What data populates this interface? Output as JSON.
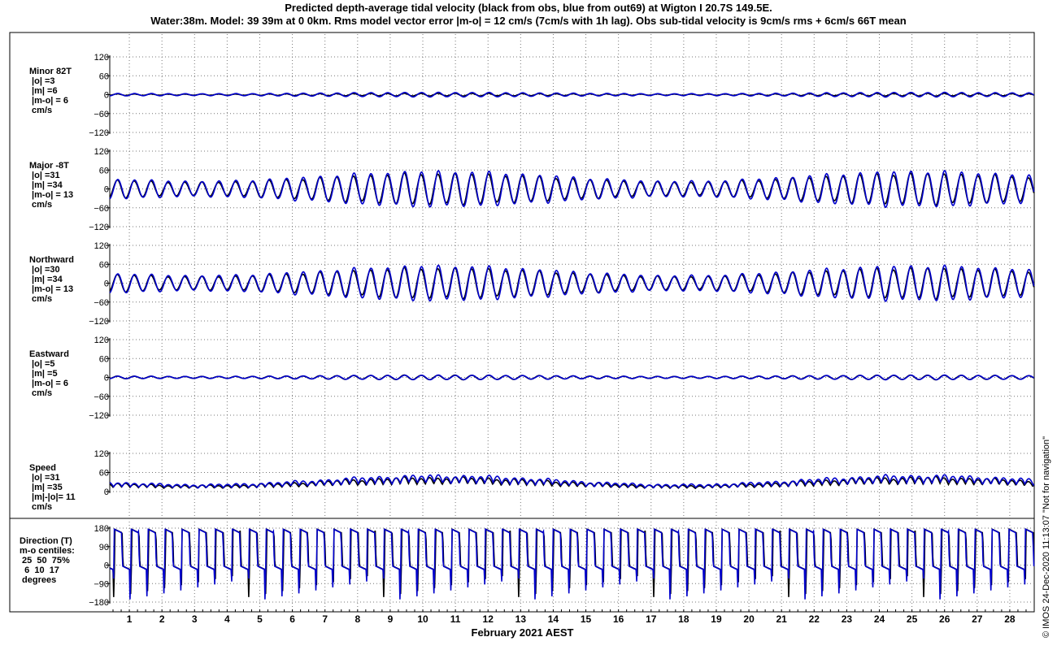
{
  "title_line1": "Predicted depth-average tidal velocity (black from obs, blue from out69) at Wigton I 20.7S 149.5E.",
  "title_line2": "Water:38m. Model: 39 39m at 0 0km. Rms model vector error |m-o| = 12 cm/s (7cm/s with 1h lag). Obs sub-tidal velocity is 9cm/s rms + 6cm/s 66T mean",
  "xlabel": "February 2021 AEST",
  "copyright": "© IMOS 24-Dec-2020 11:13:07  \"Not for navigation\"",
  "colors": {
    "obs": "#000000",
    "model": "#0000cc",
    "grid": "#777777"
  },
  "chart_data": [
    {
      "type": "line",
      "name": "minor",
      "label": [
        "Minor 82T",
        " |o| =3",
        " |m| =6",
        " |m-o| = 6",
        " cm/s"
      ],
      "ylim": [
        -120,
        120
      ],
      "yticks": [
        -120,
        -60,
        0,
        60,
        120
      ],
      "obs_amp": 4,
      "model_amp": 7,
      "tidal": true,
      "series": [
        {
          "name": "obs"
        },
        {
          "name": "model"
        }
      ]
    },
    {
      "type": "line",
      "name": "major",
      "label": [
        "Major -8T",
        " |o| =31",
        " |m| =34",
        " |m-o| = 13",
        " cm/s"
      ],
      "ylim": [
        -120,
        120
      ],
      "yticks": [
        -120,
        -60,
        0,
        60,
        120
      ],
      "obs_amp": 48,
      "model_amp": 55,
      "tidal": true,
      "series": [
        {
          "name": "obs"
        },
        {
          "name": "model"
        }
      ]
    },
    {
      "type": "line",
      "name": "northward",
      "label": [
        "Northward",
        " |o| =30",
        " |m| =34",
        " |m-o| = 13",
        " cm/s"
      ],
      "ylim": [
        -120,
        120
      ],
      "yticks": [
        -120,
        -60,
        0,
        60,
        120
      ],
      "obs_amp": 47,
      "model_amp": 54,
      "tidal": true,
      "series": [
        {
          "name": "obs"
        },
        {
          "name": "model"
        }
      ]
    },
    {
      "type": "line",
      "name": "eastward",
      "label": [
        "Eastward",
        " |o| =5",
        " |m| =5",
        " |m-o| = 6",
        " cm/s"
      ],
      "ylim": [
        -120,
        120
      ],
      "yticks": [
        -120,
        -60,
        0,
        60,
        120
      ],
      "obs_amp": 7,
      "model_amp": 7,
      "tidal": true,
      "series": [
        {
          "name": "obs"
        },
        {
          "name": "model"
        }
      ]
    },
    {
      "type": "line",
      "name": "speed",
      "label": [
        "Speed",
        " |o| =31",
        " |m| =35",
        " |m|-|o|= 11",
        " cm/s"
      ],
      "ylim": [
        0,
        120
      ],
      "yticks": [
        0,
        60,
        120
      ],
      "obs_amp": 48,
      "model_amp": 55,
      "speed": true,
      "series": [
        {
          "name": "obs"
        },
        {
          "name": "model"
        }
      ]
    },
    {
      "type": "line",
      "name": "direction",
      "label": [
        "Direction (T)",
        "m-o centiles:",
        " 25  50  75%",
        "  6  10  17",
        " degrees"
      ],
      "ylim": [
        -180,
        180
      ],
      "yticks": [
        -180,
        -90,
        0,
        90,
        180
      ],
      "direction": true,
      "series": [
        {
          "name": "obs"
        },
        {
          "name": "model"
        }
      ]
    }
  ],
  "x_axis": {
    "days": [
      "1",
      "2",
      "3",
      "4",
      "5",
      "6",
      "7",
      "8",
      "9",
      "10",
      "11",
      "12",
      "13",
      "14",
      "15",
      "16",
      "17",
      "18",
      "19",
      "20",
      "21",
      "22",
      "23",
      "24",
      "25",
      "26",
      "27",
      "28"
    ],
    "start_day": 0.4,
    "end_day": 28.75
  }
}
